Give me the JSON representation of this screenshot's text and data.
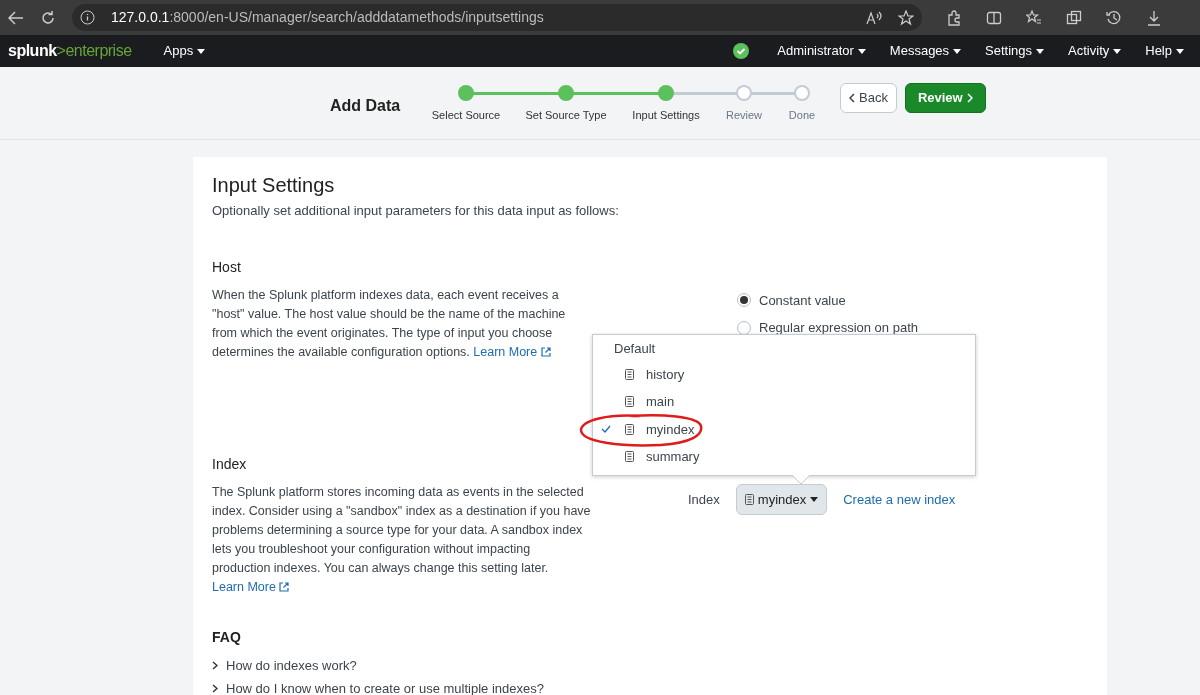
{
  "browser": {
    "url_host": "127.0.0.1",
    "url_rest": ":8000/en-US/manager/search/adddatamethods/inputsettings"
  },
  "nav": {
    "logo_brand": "splunk",
    "logo_suffix": ">enterprise",
    "apps": "Apps",
    "menus": [
      "Administrator",
      "Messages",
      "Settings",
      "Activity",
      "Help"
    ]
  },
  "wizard": {
    "title": "Add Data",
    "steps": [
      {
        "label": "Select Source",
        "completed": true
      },
      {
        "label": "Set Source Type",
        "completed": true
      },
      {
        "label": "Input Settings",
        "completed": true
      },
      {
        "label": "Review",
        "completed": false
      },
      {
        "label": "Done",
        "completed": false
      }
    ],
    "back": "Back",
    "next": "Review"
  },
  "page": {
    "title": "Input Settings",
    "subtitle": "Optionally set additional input parameters for this data input as follows:",
    "host": {
      "heading": "Host",
      "text": "When the Splunk platform indexes data, each event receives a \"host\" value. The host value should be the name of the machine from which the event originates. The type of input you choose determines the available configuration options.",
      "link": "Learn More",
      "options": [
        {
          "label": "Constant value",
          "selected": true
        },
        {
          "label": "Regular expression on path",
          "selected": false
        }
      ]
    },
    "index": {
      "heading": "Index",
      "text": "The Splunk platform stores incoming data as events in the selected index. Consider using a \"sandbox\" index as a destination if you have problems determining a source type for your data. A sandbox index lets you troubleshoot your configuration without impacting production indexes. You can always change this setting later.",
      "link": "Learn More",
      "label": "Index",
      "value": "myindex",
      "create_link": "Create a new index",
      "dropdown": {
        "group": "Default",
        "items": [
          {
            "label": "history",
            "selected": false
          },
          {
            "label": "main",
            "selected": false
          },
          {
            "label": "myindex",
            "selected": true
          },
          {
            "label": "summary",
            "selected": false
          }
        ]
      }
    },
    "faq": {
      "heading": "FAQ",
      "items": [
        "How do indexes work?",
        "How do I know when to create or use multiple indexes?"
      ]
    }
  }
}
